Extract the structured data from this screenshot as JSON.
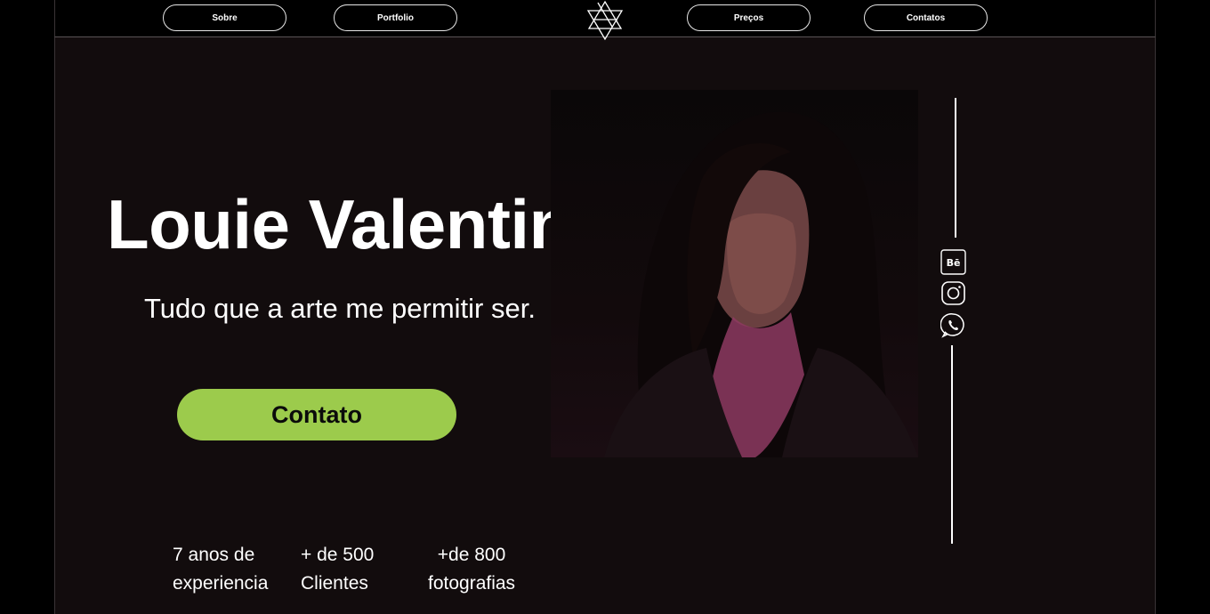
{
  "nav": {
    "items": [
      {
        "label": "Sobre"
      },
      {
        "label": "Portfolio"
      },
      {
        "label": "Preços"
      },
      {
        "label": "Contatos"
      }
    ]
  },
  "hero": {
    "name": "Louie Valentim",
    "tagline": "Tudo que a arte me permitir ser.",
    "cta_label": "Contato"
  },
  "stats": [
    {
      "line1": "7 anos de",
      "line2": "experiencia"
    },
    {
      "line1": "+ de 500",
      "line2": "Clientes"
    },
    {
      "line1": "+de 800",
      "line2": "fotografias"
    }
  ],
  "social": {
    "behance_label": "Bē"
  },
  "colors": {
    "background": "#120c0d",
    "topbar": "#000000",
    "accent": "#9ccb4c",
    "text": "#ffffff"
  },
  "icons": [
    "logo-star-icon",
    "behance-icon",
    "instagram-icon",
    "whatsapp-icon"
  ]
}
